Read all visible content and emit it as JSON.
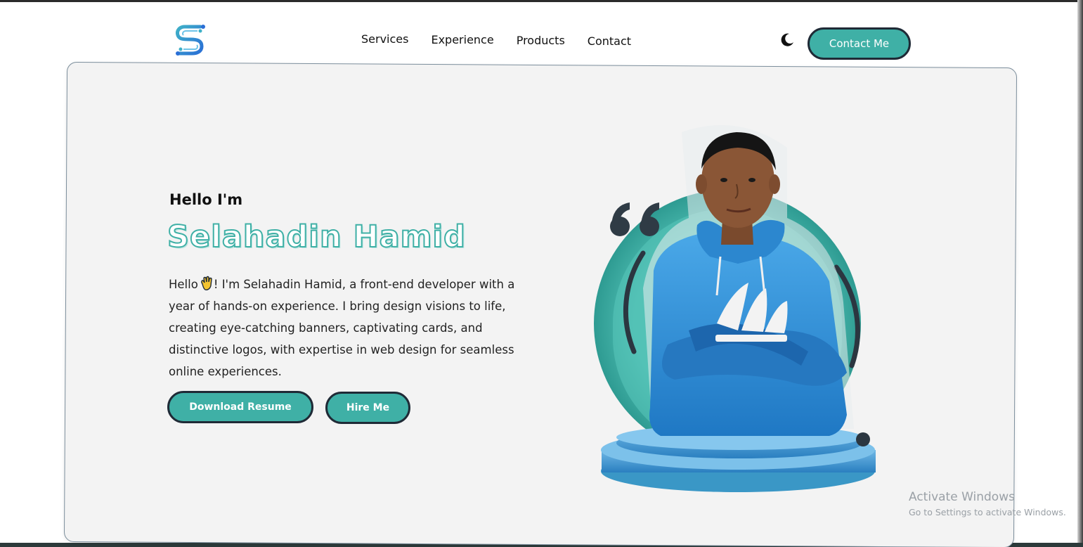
{
  "nav": {
    "links": [
      "Services",
      "Experience",
      "Products",
      "Contact"
    ],
    "contact_button": "Contact Me",
    "theme_icon": "moon-icon",
    "logo_icon": "s-circuit-logo"
  },
  "hero": {
    "greeting": "Hello I'm",
    "name": "Selahadin Hamid",
    "bio_prefix": "Hello",
    "bio_rest": "! I'm Selahadin Hamid, a front-end developer with a year of hands-on experience. I bring design visions to life, creating eye-catching banners, captivating cards, and distinctive logos, with expertise in web design for seamless online experiences.",
    "bio_emoji": "waving-hand-icon",
    "download_button": "Download Resume",
    "hire_button": "Hire Me",
    "portrait": "person-portrait-image",
    "quote_icon": "quote-icon"
  },
  "watermark": {
    "title": "Activate Windows",
    "subtitle": "Go to Settings to activate Windows."
  },
  "colors": {
    "accent": "#3fb0a6",
    "dark": "#1f2a36",
    "card_bg": "#f3f3f3",
    "logo_blue": "#2a8fd6",
    "hoodie_blue": "#2f95d8"
  }
}
